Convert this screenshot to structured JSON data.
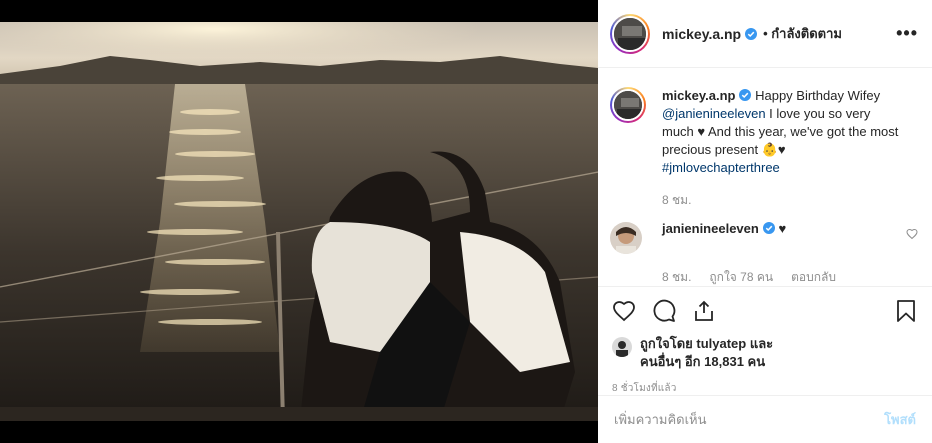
{
  "post": {
    "author": "mickey.a.np",
    "follow_label": "• กำลังติดตาม",
    "more_label": "•••",
    "photo_alt": "photo"
  },
  "caption": {
    "username": "mickey.a.np",
    "text_1": "Happy Birthday Wifey",
    "mention": "@janienineeleven",
    "text_2": " I love you so very much ♥ And this year, we've got the most precious present 👶♥",
    "hashtag": "#jmlovechapterthree",
    "time": "8 ชม."
  },
  "reply": {
    "username": "janienineeleven",
    "text": "♥",
    "time": "8 ชม.",
    "likes": "ถูกใจ 78 คน",
    "reply_label": "ตอบกลับ"
  },
  "likes": {
    "prefix": "ถูกใจโดย ",
    "liker": "tulyatep",
    "suffix": " และ",
    "others": "คนอื่นๆ อีก 18,831 คน"
  },
  "timestamp": "8 ชั่วโมงที่แล้ว",
  "comment_box": {
    "placeholder": "เพิ่มความคิดเห็น",
    "post_label": "โพสต์"
  },
  "colors": {
    "verified": "#3897f0",
    "link": "#00376b",
    "muted": "#8e8e8e",
    "post_disabled": "#b2dffc"
  },
  "icons": [
    "verified-icon",
    "heart-icon",
    "comment-icon",
    "share-icon",
    "bookmark-icon",
    "small-heart-icon"
  ]
}
